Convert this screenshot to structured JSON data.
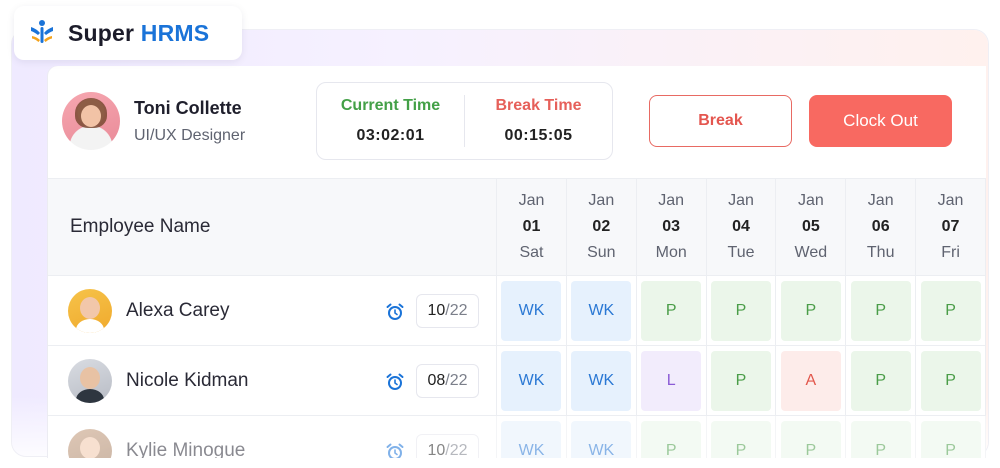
{
  "brand": {
    "name_part1": "Super",
    "name_part2": "HRMS",
    "accent": "#1a73d8"
  },
  "profile": {
    "name": "Toni Collette",
    "role": "UI/UX Designer"
  },
  "timers": {
    "current_label": "Current Time",
    "current_value": "03:02:01",
    "break_label": "Break Time",
    "break_value": "00:15:05"
  },
  "actions": {
    "break_label": "Break",
    "clockout_label": "Clock Out"
  },
  "table": {
    "name_header": "Employee Name",
    "days": [
      {
        "month": "Jan",
        "day": "01",
        "weekday": "Sat"
      },
      {
        "month": "Jan",
        "day": "02",
        "weekday": "Sun"
      },
      {
        "month": "Jan",
        "day": "03",
        "weekday": "Mon"
      },
      {
        "month": "Jan",
        "day": "04",
        "weekday": "Tue"
      },
      {
        "month": "Jan",
        "day": "05",
        "weekday": "Wed"
      },
      {
        "month": "Jan",
        "day": "06",
        "weekday": "Thu"
      },
      {
        "month": "Jan",
        "day": "07",
        "weekday": "Fri"
      }
    ],
    "rows": [
      {
        "name": "Alexa Carey",
        "attended": "10",
        "separator": "/",
        "total": "22",
        "statuses": [
          "WK",
          "WK",
          "P",
          "P",
          "P",
          "P",
          "P"
        ]
      },
      {
        "name": "Nicole Kidman",
        "attended": "08",
        "separator": "/",
        "total": "22",
        "statuses": [
          "WK",
          "WK",
          "L",
          "P",
          "A",
          "P",
          "P"
        ]
      },
      {
        "name": "Kylie Minogue",
        "attended": "10",
        "separator": "/",
        "total": "22",
        "statuses": [
          "WK",
          "WK",
          "P",
          "P",
          "P",
          "P",
          "P"
        ]
      }
    ]
  },
  "colors": {
    "status_wk": "#2a78d4",
    "status_p": "#4a9d48",
    "status_l": "#8b5bd6",
    "status_a": "#e2574c",
    "clockout_bg": "#f86961",
    "current_time": "#43a047",
    "break_time": "#e6605a"
  },
  "icons": {
    "logo": "hrms-logo-icon",
    "timer": "alarm-clock-icon"
  }
}
